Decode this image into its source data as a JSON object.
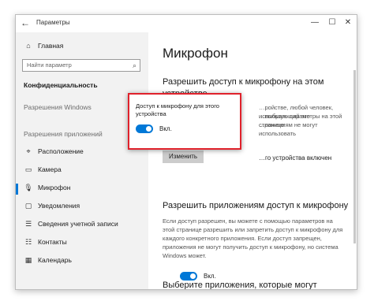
{
  "window": {
    "back_icon": "back-arrow-icon",
    "title": "Параметры",
    "controls": [
      "—",
      "☐",
      "✕"
    ]
  },
  "sidebar": {
    "home": "Главная",
    "search_placeholder": "Найти параметр",
    "section_title": "Конфиденциальность",
    "windows_permissions": "Разрешения Windows",
    "app_permissions": "Разрешения приложений",
    "items": [
      {
        "label": "Расположение",
        "icon": "location-icon"
      },
      {
        "label": "Камера",
        "icon": "camera-icon"
      },
      {
        "label": "Микрофон",
        "icon": "microphone-icon"
      },
      {
        "label": "Уведомления",
        "icon": "notifications-icon"
      },
      {
        "label": "Сведения учетной записи",
        "icon": "account-icon"
      },
      {
        "label": "Контакты",
        "icon": "contacts-icon"
      },
      {
        "label": "Календарь",
        "icon": "calendar-icon"
      }
    ]
  },
  "main": {
    "title": "Микрофон",
    "section1_heading": "Разрешить доступ к микрофону на этом устройстве",
    "section1_desc_lines": [
      "…ройстве, любой человек, использующий это",
      "…выбрать параметры на этой странице",
      "…ложениям не могут использовать"
    ],
    "device_status": "…го устройства включен",
    "change_button": "Изменить",
    "section2_heading": "Разрешить приложениям доступ к микрофону",
    "section2_desc": "Если доступ разрешен, вы можете с помощью параметров на этой странице разрешить или запретить доступ к микрофону для каждого конкретного приложения. Если доступ запрещен, приложения не могут получить доступ к микрофону, но система Windows может.",
    "toggle_label": "Вкл.",
    "section3_heading": "Выберите приложения, которые могут"
  },
  "popup": {
    "title": "Доступ к микрофону для этого устройства",
    "toggle_label": "Вкл."
  }
}
